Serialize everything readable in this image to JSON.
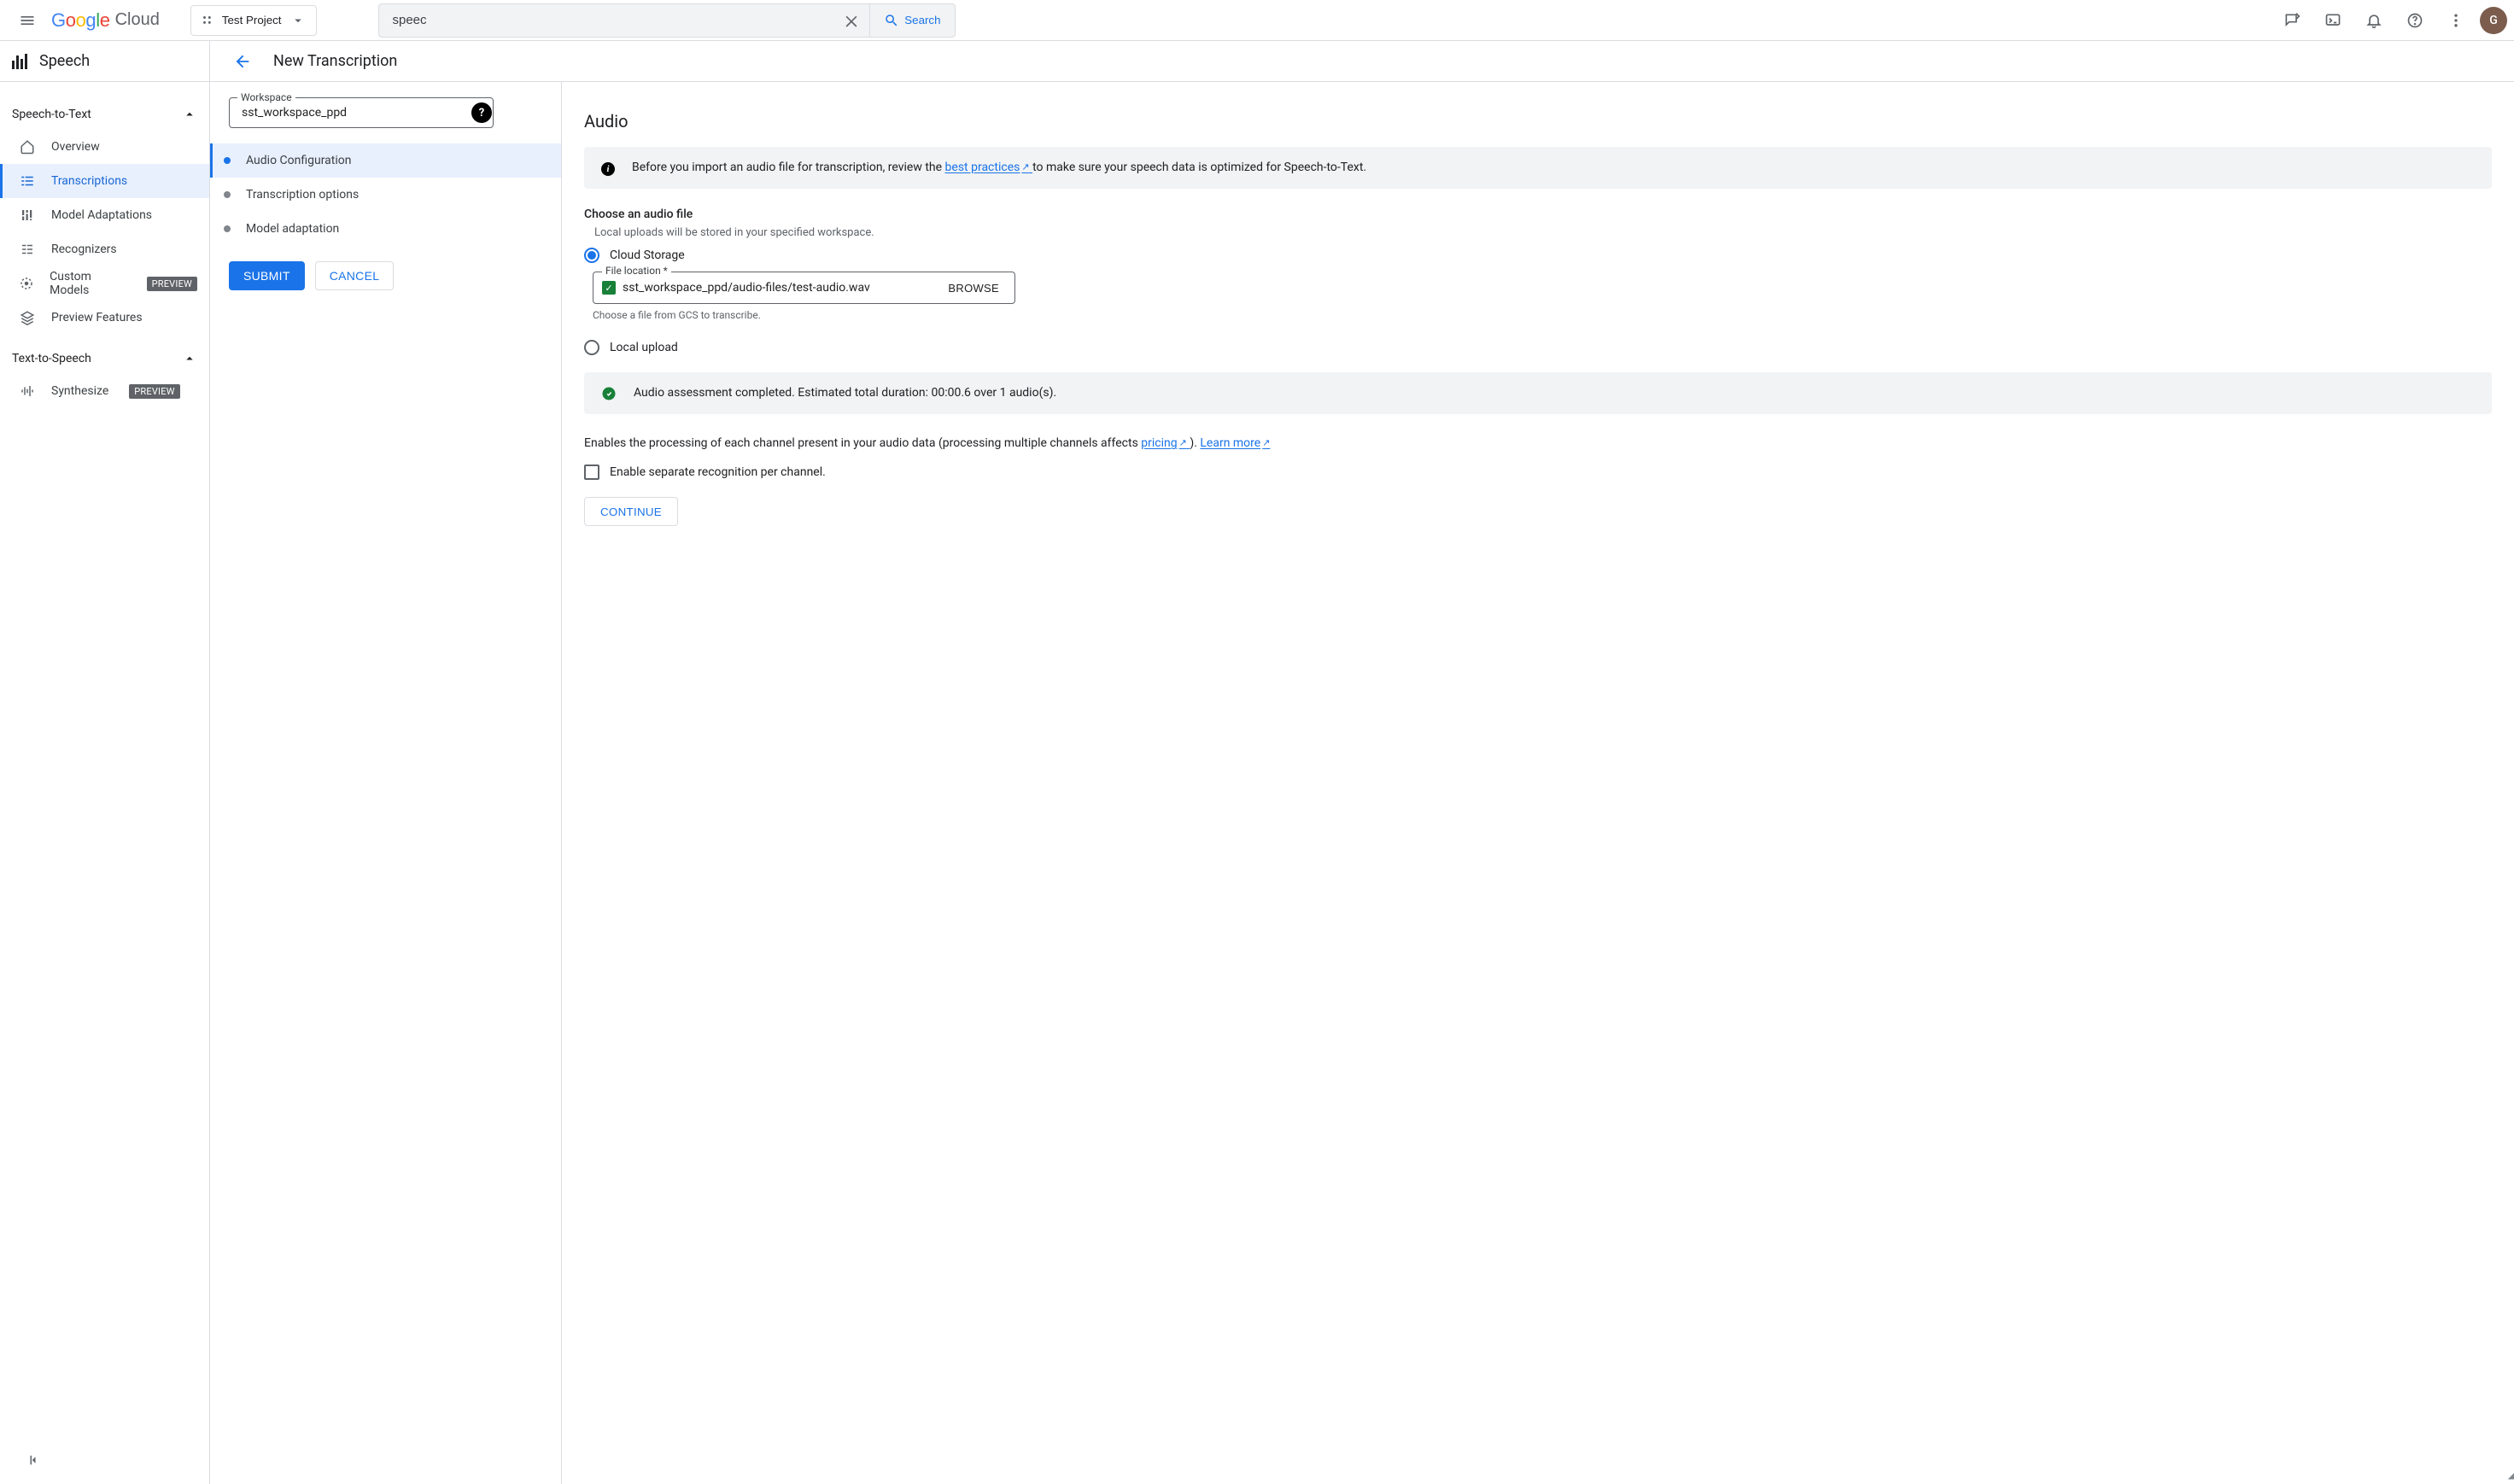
{
  "topbar": {
    "project": "Test Project",
    "search_value": "speec",
    "search_button": "Search",
    "avatar_letter": "G"
  },
  "prodbar": {
    "product": "Speech",
    "page_title": "New Transcription"
  },
  "nav": {
    "group1": "Speech-to-Text",
    "items1": {
      "overview": "Overview",
      "transcriptions": "Transcriptions",
      "model_adaptations": "Model Adaptations",
      "recognizers": "Recognizers",
      "custom_models": "Custom Models",
      "preview_features": "Preview Features"
    },
    "group2": "Text-to-Speech",
    "items2": {
      "synthesize": "Synthesize"
    },
    "preview_chip": "PREVIEW"
  },
  "mid": {
    "workspace_label": "Workspace",
    "workspace_value": "sst_workspace_ppd",
    "steps": {
      "audio": "Audio Configuration",
      "options": "Transcription options",
      "model": "Model adaptation"
    },
    "submit": "SUBMIT",
    "cancel": "CANCEL"
  },
  "content": {
    "section": "Audio",
    "notice_pre": "Before you import an audio file for transcription, review the ",
    "notice_link": "best practices",
    "notice_post": " to make sure your speech data is optimized for Speech-to-Text.",
    "choose_header": "Choose an audio file",
    "choose_hint": "Local uploads will be stored in your specified workspace.",
    "radio_cloud": "Cloud Storage",
    "radio_local": "Local upload",
    "file_label": "File location *",
    "file_value": "sst_workspace_ppd/audio-files/test-audio.wav",
    "file_hint": "Choose a file from GCS to transcribe.",
    "browse": "BROWSE",
    "assessment": "Audio assessment completed. Estimated total duration: 00:00.6 over 1 audio(s).",
    "channel_pre": "Enables the processing of each channel present in your audio data (processing multiple channels affects ",
    "channel_pricing": "pricing",
    "channel_mid": " ). ",
    "channel_learn": "Learn more",
    "channel_checkbox": "Enable separate recognition per channel.",
    "continue": "CONTINUE"
  }
}
